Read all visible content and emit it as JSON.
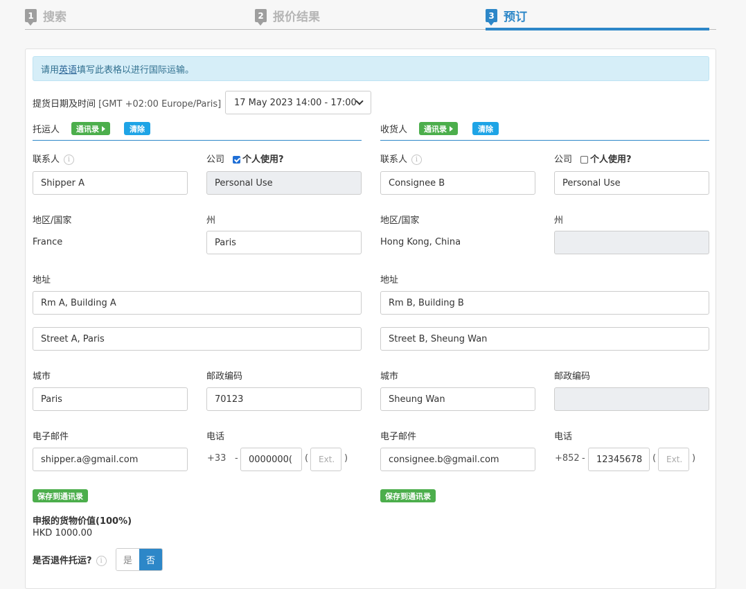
{
  "steps": [
    {
      "num": "1",
      "label": "搜索"
    },
    {
      "num": "2",
      "label": "报价结果"
    },
    {
      "num": "3",
      "label": "预订"
    }
  ],
  "notice": {
    "prefix": "请用",
    "link": "英语",
    "suffix": "填写此表格以进行国际运输。"
  },
  "pickup": {
    "label": "提货日期及时间",
    "timezone": "[GMT +02:00 Europe/Paris]",
    "value": "17 May 2023 14:00 - 17:00"
  },
  "buttons": {
    "address_book": "通讯录",
    "clear": "清除",
    "save_to_book": "保存到通讯录"
  },
  "labels": {
    "contact": "联系人",
    "company": "公司",
    "personal_use": "个人使用?",
    "region": "地区/国家",
    "state": "州",
    "address": "地址",
    "city": "城市",
    "postcode": "邮政编码",
    "email": "电子邮件",
    "phone": "电话",
    "ext_placeholder": "Ext."
  },
  "shipper": {
    "title": "托运人",
    "contact": "Shipper A",
    "personal_use_checked": true,
    "company": "Personal Use",
    "country": "France",
    "state": "Paris",
    "address1": "Rm A, Building A",
    "address2": "Street A, Paris",
    "city": "Paris",
    "postcode": "70123",
    "email": "shipper.a@gmail.com",
    "phone_code": "+33",
    "phone": "0000000("
  },
  "consignee": {
    "title": "收货人",
    "contact": "Consignee B",
    "personal_use_checked": false,
    "company": "Personal Use",
    "country": "Hong Kong, China",
    "state": "",
    "address1": "Rm B, Building B",
    "address2": "Street B, Sheung Wan",
    "city": "Sheung Wan",
    "postcode": "",
    "email": "consignee.b@gmail.com",
    "phone_code": "+852",
    "phone": "12345678"
  },
  "declared": {
    "label": "申报的货物价值(100%)",
    "value": "HKD 1000.00"
  },
  "return_shipment": {
    "label": "是否退件托运?",
    "yes": "是",
    "no": "否",
    "selected": "否"
  },
  "colors": {
    "accent": "#2d87c8",
    "green": "#4cae4c",
    "blue_btn": "#1ea4e6",
    "notice_bg": "#d6eef8"
  }
}
